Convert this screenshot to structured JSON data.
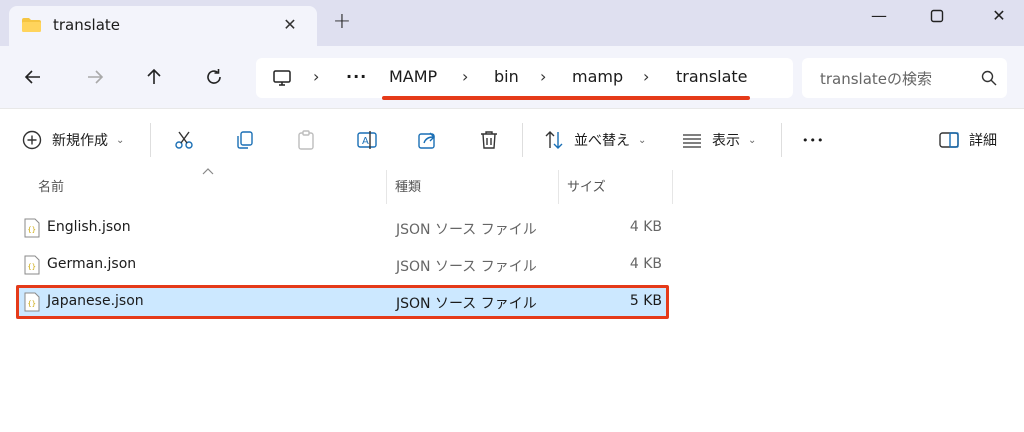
{
  "tab": {
    "title": "translate"
  },
  "address": {
    "overflow": "···",
    "segments": [
      "MAMP",
      "bin",
      "mamp",
      "translate"
    ]
  },
  "search": {
    "placeholder": "translateの検索"
  },
  "toolbar": {
    "new_label": "新規作成",
    "sort_label": "並べ替え",
    "view_label": "表示",
    "more_label": "•••",
    "details_label": "詳細"
  },
  "columns": {
    "name": "名前",
    "type": "種類",
    "size": "サイズ"
  },
  "files": [
    {
      "name": "English.json",
      "type": "JSON ソース ファイル",
      "size": "4 KB",
      "selected": false
    },
    {
      "name": "German.json",
      "type": "JSON ソース ファイル",
      "size": "4 KB",
      "selected": false
    },
    {
      "name": "Japanese.json",
      "type": "JSON ソース ファイル",
      "size": "5 KB",
      "selected": true
    }
  ],
  "colors": {
    "accent_red": "#e53a19",
    "selection": "#cce8ff",
    "chrome": "#dfe0f0",
    "navbar": "#f3f4fb"
  },
  "icons": {
    "tab": "folder-icon",
    "back": "back-arrow-icon",
    "forward": "forward-arrow-icon",
    "up": "up-arrow-icon",
    "refresh": "refresh-icon",
    "computer": "computer-icon",
    "search": "search-icon",
    "file": "json-file-icon"
  }
}
